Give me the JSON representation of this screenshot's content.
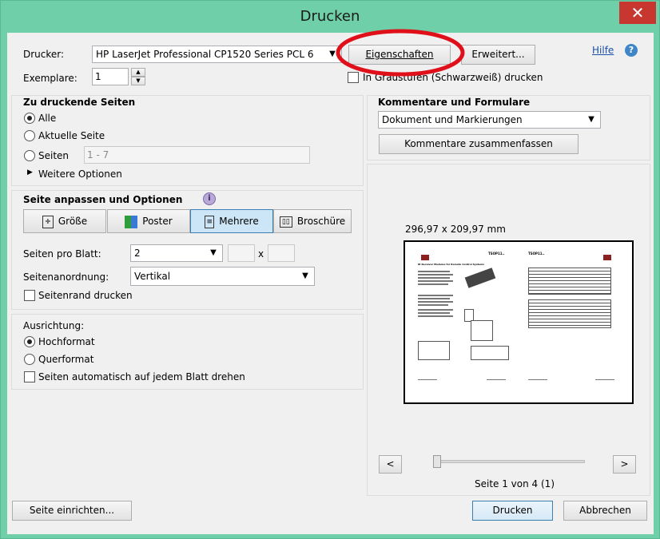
{
  "window": {
    "title": "Drucken",
    "close_label": "✕"
  },
  "printer": {
    "label": "Drucker:",
    "selected": "HP LaserJet Professional CP1520 Series PCL 6",
    "properties_label": "Eigenschaften",
    "advanced_label": "Erweitert...",
    "help_label": "Hilfe",
    "grayscale_label": "In Graustufen (Schwarzweiß) drucken",
    "copies_label": "Exemplare:",
    "copies_value": "1"
  },
  "pages": {
    "title": "Zu druckende Seiten",
    "all_label": "Alle",
    "current_label": "Aktuelle Seite",
    "pages_label": "Seiten",
    "pages_value": "1 - 7",
    "more_options_label": "Weitere Optionen"
  },
  "fit": {
    "title": "Seite anpassen und Optionen",
    "size_label": "Größe",
    "poster_label": "Poster",
    "multiple_label": "Mehrere",
    "booklet_label": "Broschüre",
    "pages_per_sheet_label": "Seiten pro Blatt:",
    "pages_per_sheet_value": "2",
    "x_label": "x",
    "order_label": "Seitenanordnung:",
    "order_value": "Vertikal",
    "border_label": "Seitenrand drucken"
  },
  "orientation": {
    "title": "Ausrichtung:",
    "portrait_label": "Hochformat",
    "landscape_label": "Querformat",
    "auto_rotate_label": "Seiten automatisch auf jedem Blatt drehen"
  },
  "comments": {
    "title": "Kommentare und Formulare",
    "selected": "Dokument und Markierungen",
    "summarize_label": "Kommentare zusammenfassen"
  },
  "preview": {
    "dimensions": "296,97 x 209,97 mm",
    "prev_label": "<",
    "next_label": ">",
    "page_status": "Seite 1 von 4 (1)",
    "left_heading": "TSOP11..",
    "right_heading": "TSOP11..",
    "left_subtitle": "IR Receiver Modules for Remote Control Systems",
    "progress_fraction": 0.0
  },
  "footer": {
    "page_setup_label": "Seite einrichten...",
    "print_label": "Drucken",
    "cancel_label": "Abbrechen"
  },
  "colors": {
    "frame": "#6fcfa8",
    "close": "#c7372f",
    "annotation_circle": "#e0101a"
  }
}
